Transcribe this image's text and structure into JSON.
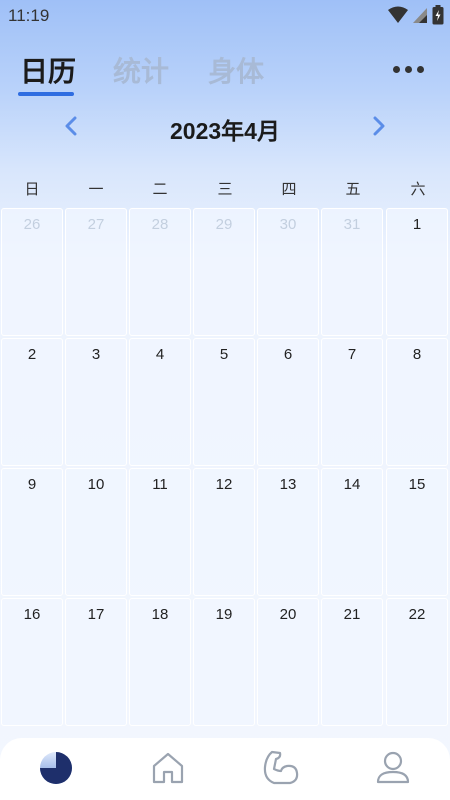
{
  "status_bar": {
    "time": "11:19"
  },
  "tabs": [
    {
      "label": "日历",
      "active": true
    },
    {
      "label": "统计",
      "active": false
    },
    {
      "label": "身体",
      "active": false
    }
  ],
  "more_icon": "more-dots-icon",
  "month_nav": {
    "title": "2023年4月",
    "prev_icon": "chevron-left-icon",
    "next_icon": "chevron-right-icon"
  },
  "weekdays": [
    "日",
    "一",
    "二",
    "三",
    "四",
    "五",
    "六"
  ],
  "calendar": {
    "weeks": [
      [
        {
          "day": "26",
          "current": false
        },
        {
          "day": "27",
          "current": false
        },
        {
          "day": "28",
          "current": false
        },
        {
          "day": "29",
          "current": false
        },
        {
          "day": "30",
          "current": false
        },
        {
          "day": "31",
          "current": false
        },
        {
          "day": "1",
          "current": true
        }
      ],
      [
        {
          "day": "2",
          "current": true
        },
        {
          "day": "3",
          "current": true
        },
        {
          "day": "4",
          "current": true
        },
        {
          "day": "5",
          "current": true
        },
        {
          "day": "6",
          "current": true
        },
        {
          "day": "7",
          "current": true
        },
        {
          "day": "8",
          "current": true
        }
      ],
      [
        {
          "day": "9",
          "current": true
        },
        {
          "day": "10",
          "current": true
        },
        {
          "day": "11",
          "current": true
        },
        {
          "day": "12",
          "current": true
        },
        {
          "day": "13",
          "current": true
        },
        {
          "day": "14",
          "current": true
        },
        {
          "day": "15",
          "current": true
        }
      ],
      [
        {
          "day": "16",
          "current": true
        },
        {
          "day": "17",
          "current": true
        },
        {
          "day": "18",
          "current": true
        },
        {
          "day": "19",
          "current": true
        },
        {
          "day": "20",
          "current": true
        },
        {
          "day": "21",
          "current": true
        },
        {
          "day": "22",
          "current": true
        }
      ]
    ]
  },
  "bottom_nav": [
    {
      "icon": "calendar-progress-icon",
      "active": true
    },
    {
      "icon": "home-icon",
      "active": false
    },
    {
      "icon": "body-muscle-icon",
      "active": false
    },
    {
      "icon": "profile-icon",
      "active": false
    }
  ],
  "colors": {
    "accent": "#2f6de1",
    "inactive_tab": "#a8bad6",
    "arrow": "#5b8de8",
    "icon_gray": "#9aa3b0",
    "other_month_text": "#c3cfdf"
  }
}
